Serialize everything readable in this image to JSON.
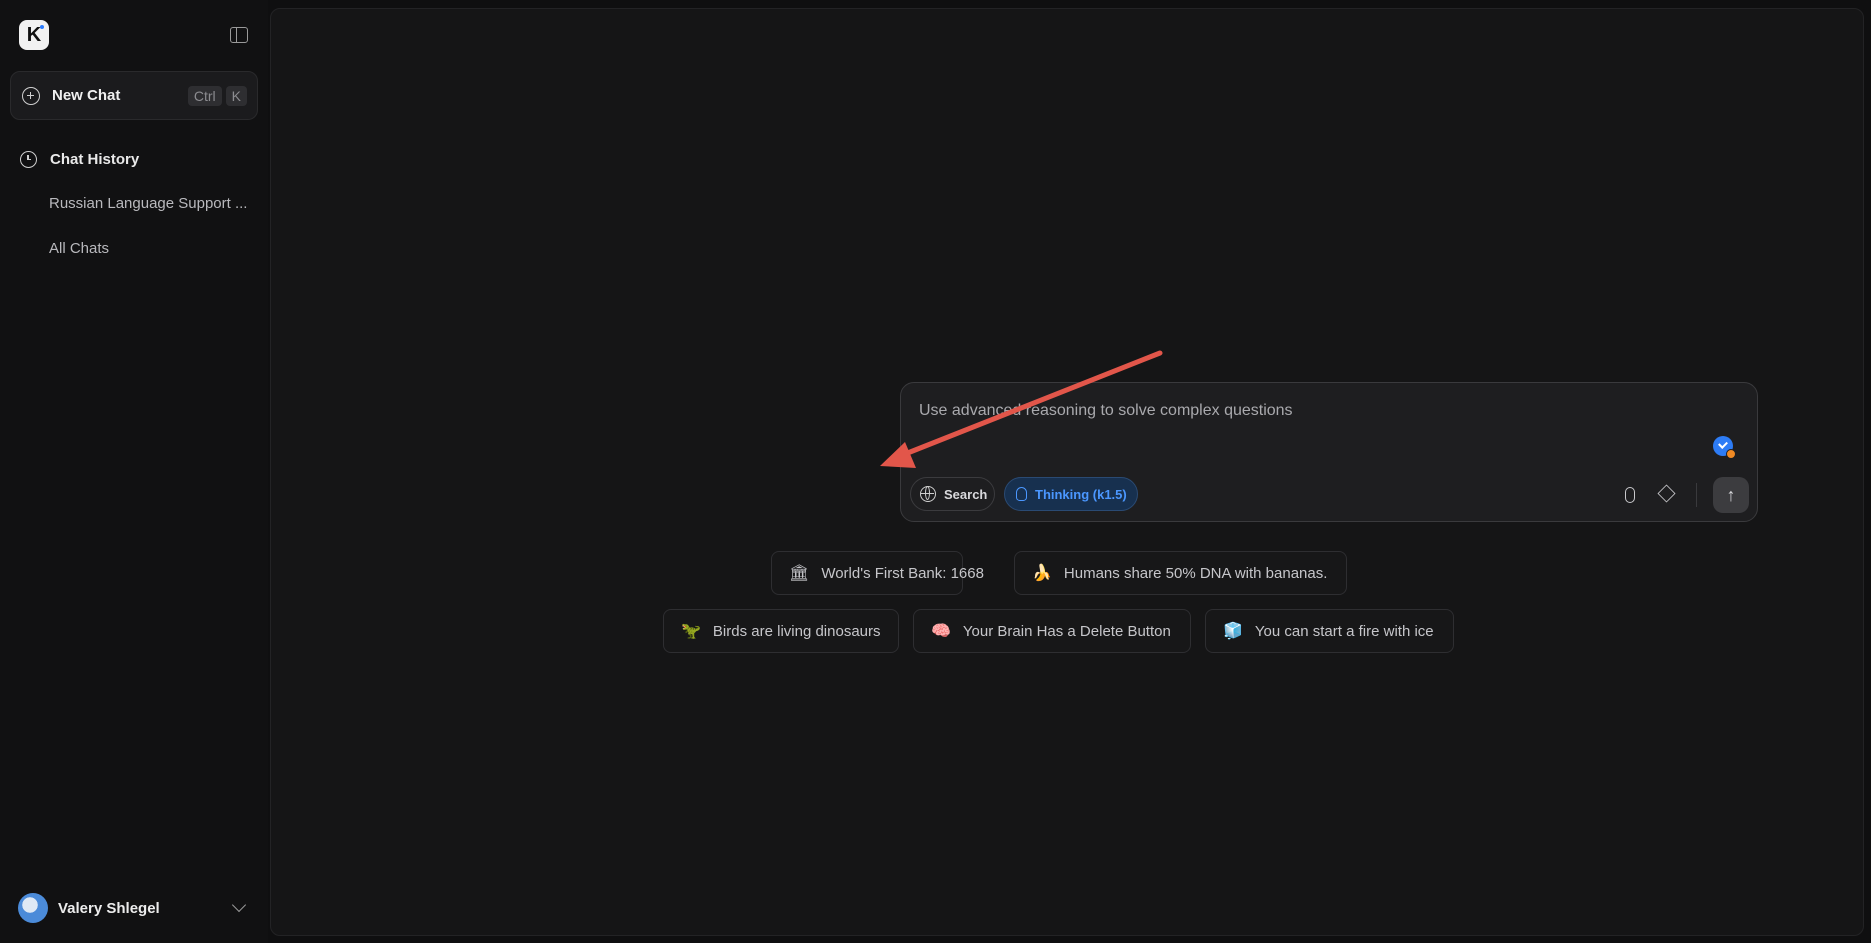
{
  "sidebar": {
    "logo_letter": "K",
    "new_chat": {
      "label": "New Chat",
      "shortcut_keys": [
        "Ctrl",
        "K"
      ]
    },
    "chat_history_label": "Chat History",
    "history_items": [
      "Russian Language Support ...",
      "All Chats"
    ],
    "user": {
      "name": "Valery Shlegel"
    }
  },
  "composer": {
    "placeholder": "Use advanced reasoning to solve complex questions",
    "search_label": "Search",
    "thinking_label": "Thinking (k1.5)",
    "send_icon": "↑"
  },
  "suggestions": [
    {
      "icon": "🏛",
      "text": "World's First Bank: 1668"
    },
    {
      "icon": "🍌",
      "text": "Humans share 50% DNA with bananas."
    },
    {
      "icon": "🦖",
      "text": "Birds are living dinosaurs"
    },
    {
      "icon": "🧠",
      "text": "Your Brain Has a Delete Button"
    },
    {
      "icon": "🧊",
      "text": "You can start a fire with ice"
    }
  ],
  "colors": {
    "accent": "#4b97ff",
    "annotation_arrow": "#e2564a"
  }
}
